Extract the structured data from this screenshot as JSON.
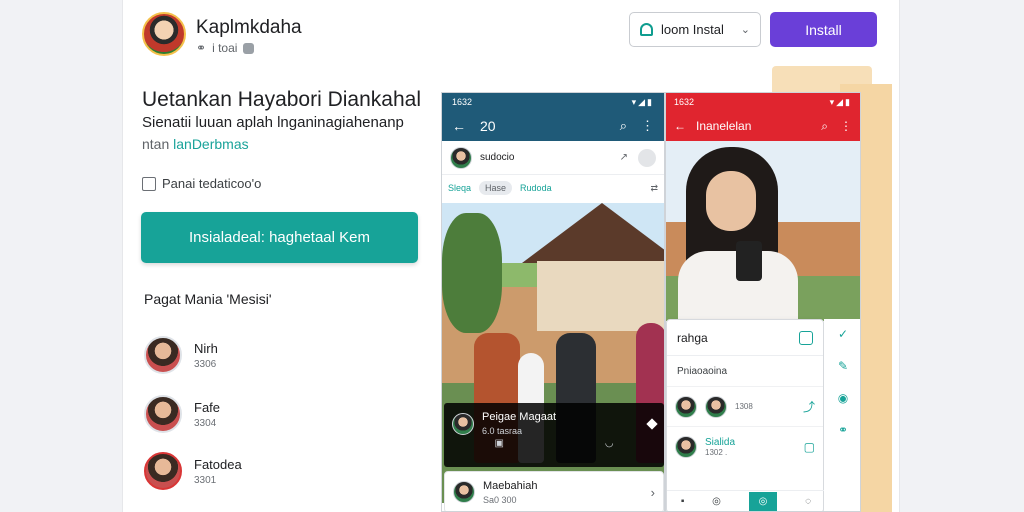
{
  "header": {
    "app_name": "Kaplmkdaha",
    "app_meta": "i toai",
    "select_label": "loom Instal",
    "install_label": "Install"
  },
  "intro": {
    "headline": "Uetankan Hayabori Diankahal",
    "subtext": "Sienatii luuan aplah lnganinagiahenanp",
    "link_prefix": "ntan",
    "link_accent": "lanDerbmas",
    "feature": "Panai tedaticoo'o",
    "cta": "Insialadeal: haghetaal Kem"
  },
  "members": {
    "title": "Pagat Mania 'Mesisi'",
    "items": [
      {
        "name": "Nirh",
        "sub": "3306"
      },
      {
        "name": "Fafe",
        "sub": "3304"
      },
      {
        "name": "Fatodea",
        "sub": "3301"
      }
    ]
  },
  "phone_a": {
    "status_time": "1632",
    "toolbar_title": "20",
    "post_author": "sudocio",
    "tags": [
      "Sleqa",
      "Hase",
      "Rudoda"
    ],
    "overlay_title": "Peigae Magaat",
    "overlay_sub": "6.0 tasraa",
    "bottom_title": "Maebahiah",
    "bottom_sub": "Sa0 300"
  },
  "phone_b": {
    "status_time": "1632",
    "toolbar_title": "Inanelelan",
    "sheet_title": "rahga",
    "sheet_section": "Pniaoaoina",
    "sheet_items": [
      {
        "name": "",
        "sub": "1308"
      },
      {
        "name": "Sialida",
        "sub": "1302 ."
      }
    ]
  },
  "colors": {
    "teal": "#17a398",
    "purple": "#6a3fd8",
    "red_bar": "#e0252f",
    "blue_bar": "#1f5a78"
  }
}
